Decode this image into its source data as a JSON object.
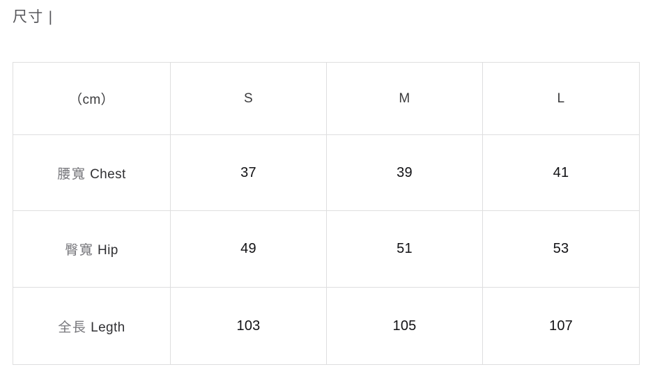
{
  "section": {
    "title": "尺寸 |"
  },
  "table": {
    "columns": [
      "（cm）",
      "S",
      "M",
      "L"
    ],
    "rows": [
      {
        "label_cjk": "腰寬",
        "label_latin": "Chest",
        "values": [
          "37",
          "39",
          "41"
        ]
      },
      {
        "label_cjk": "臀寬",
        "label_latin": "Hip",
        "values": [
          "49",
          "51",
          "53"
        ]
      },
      {
        "label_cjk": "全長",
        "label_latin": "Legth",
        "values": [
          "103",
          "105",
          "107"
        ]
      }
    ]
  },
  "colors": {
    "border": "#dededf",
    "title_text": "#56565a",
    "header_text": "#3a3a3c",
    "cjk_label_text": "#75757a",
    "value_text": "#111114",
    "background": "#ffffff"
  }
}
